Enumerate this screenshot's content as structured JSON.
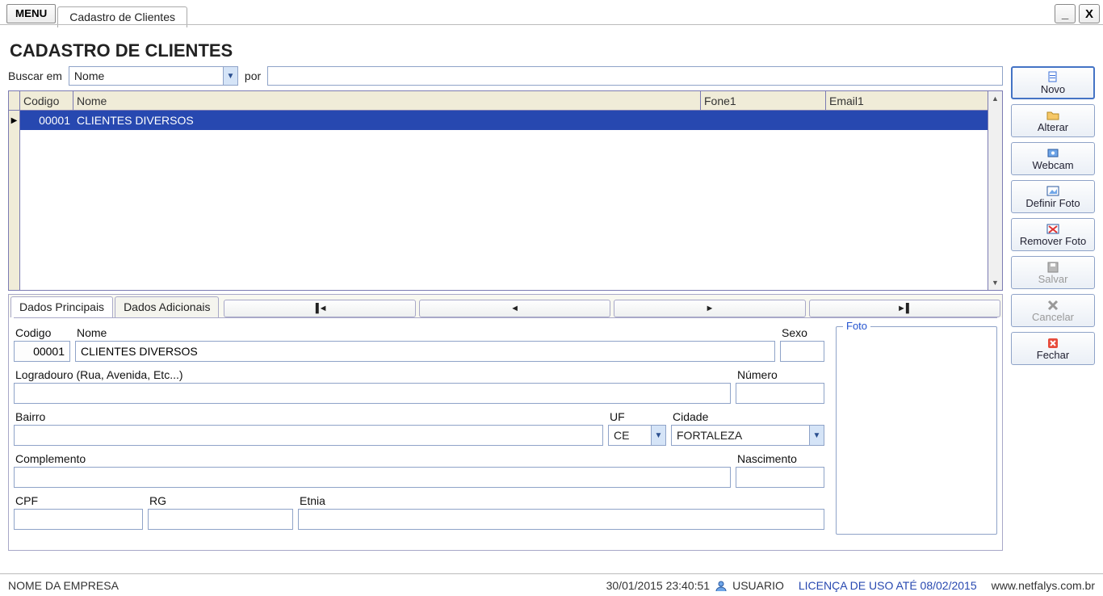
{
  "window": {
    "menu_label": "MENU",
    "tab_label": "Cadastro de Clientes",
    "minimize": "_",
    "close": "X"
  },
  "page": {
    "title": "CADASTRO DE CLIENTES"
  },
  "search": {
    "label_field": "Buscar em",
    "field_value": "Nome",
    "label_term": "por",
    "term_value": ""
  },
  "grid": {
    "columns": [
      "Codigo",
      "Nome",
      "Fone1",
      "Email1"
    ],
    "rows": [
      {
        "codigo": "00001",
        "nome": "CLIENTES DIVERSOS",
        "fone1": "",
        "email1": ""
      }
    ]
  },
  "tabs": {
    "principal": "Dados Principais",
    "adicionais": "Dados Adicionais"
  },
  "nav": {
    "first": "▐◄",
    "prev": "◄",
    "next": "►",
    "last": "►▌"
  },
  "form": {
    "codigo_label": "Codigo",
    "codigo_value": "00001",
    "nome_label": "Nome",
    "nome_value": "CLIENTES DIVERSOS",
    "sexo_label": "Sexo",
    "sexo_value": "",
    "logradouro_label": "Logradouro (Rua, Avenida, Etc...)",
    "logradouro_value": "",
    "numero_label": "Número",
    "numero_value": "",
    "bairro_label": "Bairro",
    "bairro_value": "",
    "uf_label": "UF",
    "uf_value": "CE",
    "cidade_label": "Cidade",
    "cidade_value": "FORTALEZA",
    "complemento_label": "Complemento",
    "complemento_value": "",
    "nascimento_label": "Nascimento",
    "nascimento_value": "",
    "cpf_label": "CPF",
    "cpf_value": "",
    "rg_label": "RG",
    "rg_value": "",
    "etnia_label": "Etnia",
    "etnia_value": "",
    "foto_label": "Foto"
  },
  "actions": {
    "novo": "Novo",
    "alterar": "Alterar",
    "webcam": "Webcam",
    "definir_foto": "Definir Foto",
    "remover_foto": "Remover Foto",
    "salvar": "Salvar",
    "cancelar": "Cancelar",
    "fechar": "Fechar"
  },
  "status": {
    "company": "NOME DA EMPRESA",
    "datetime": "30/01/2015 23:40:51",
    "user": "USUARIO",
    "license": "LICENÇA DE USO ATÉ 08/02/2015",
    "site": "www.netfalys.com.br"
  }
}
